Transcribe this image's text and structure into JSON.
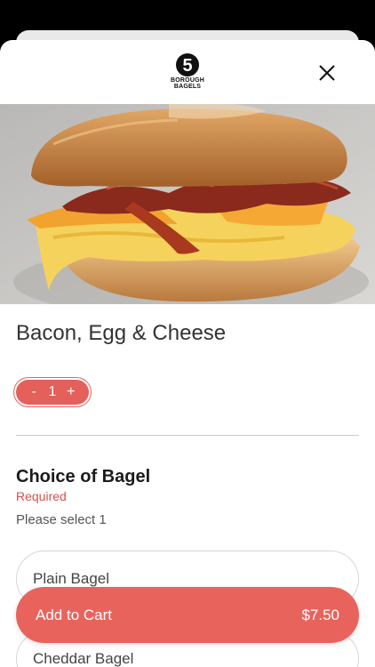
{
  "brand": {
    "logo_number": "5",
    "logo_line1": "BOROUGH",
    "logo_line2": "BAGELS"
  },
  "item": {
    "title": "Bacon, Egg & Cheese",
    "image_icon": "bacon-egg-cheese-bagel-photo"
  },
  "quantity": {
    "minus": "-",
    "value": "1",
    "plus": "+"
  },
  "choice_group": {
    "title": "Choice of Bagel",
    "required_label": "Required",
    "instruction": "Please select 1",
    "options": [
      {
        "label": "Plain Bagel"
      },
      {
        "label": "Cheddar Bagel"
      }
    ]
  },
  "cart": {
    "label": "Add to Cart",
    "price": "$7.50"
  },
  "colors": {
    "accent": "#e9635d",
    "required_text": "#d4514b"
  }
}
